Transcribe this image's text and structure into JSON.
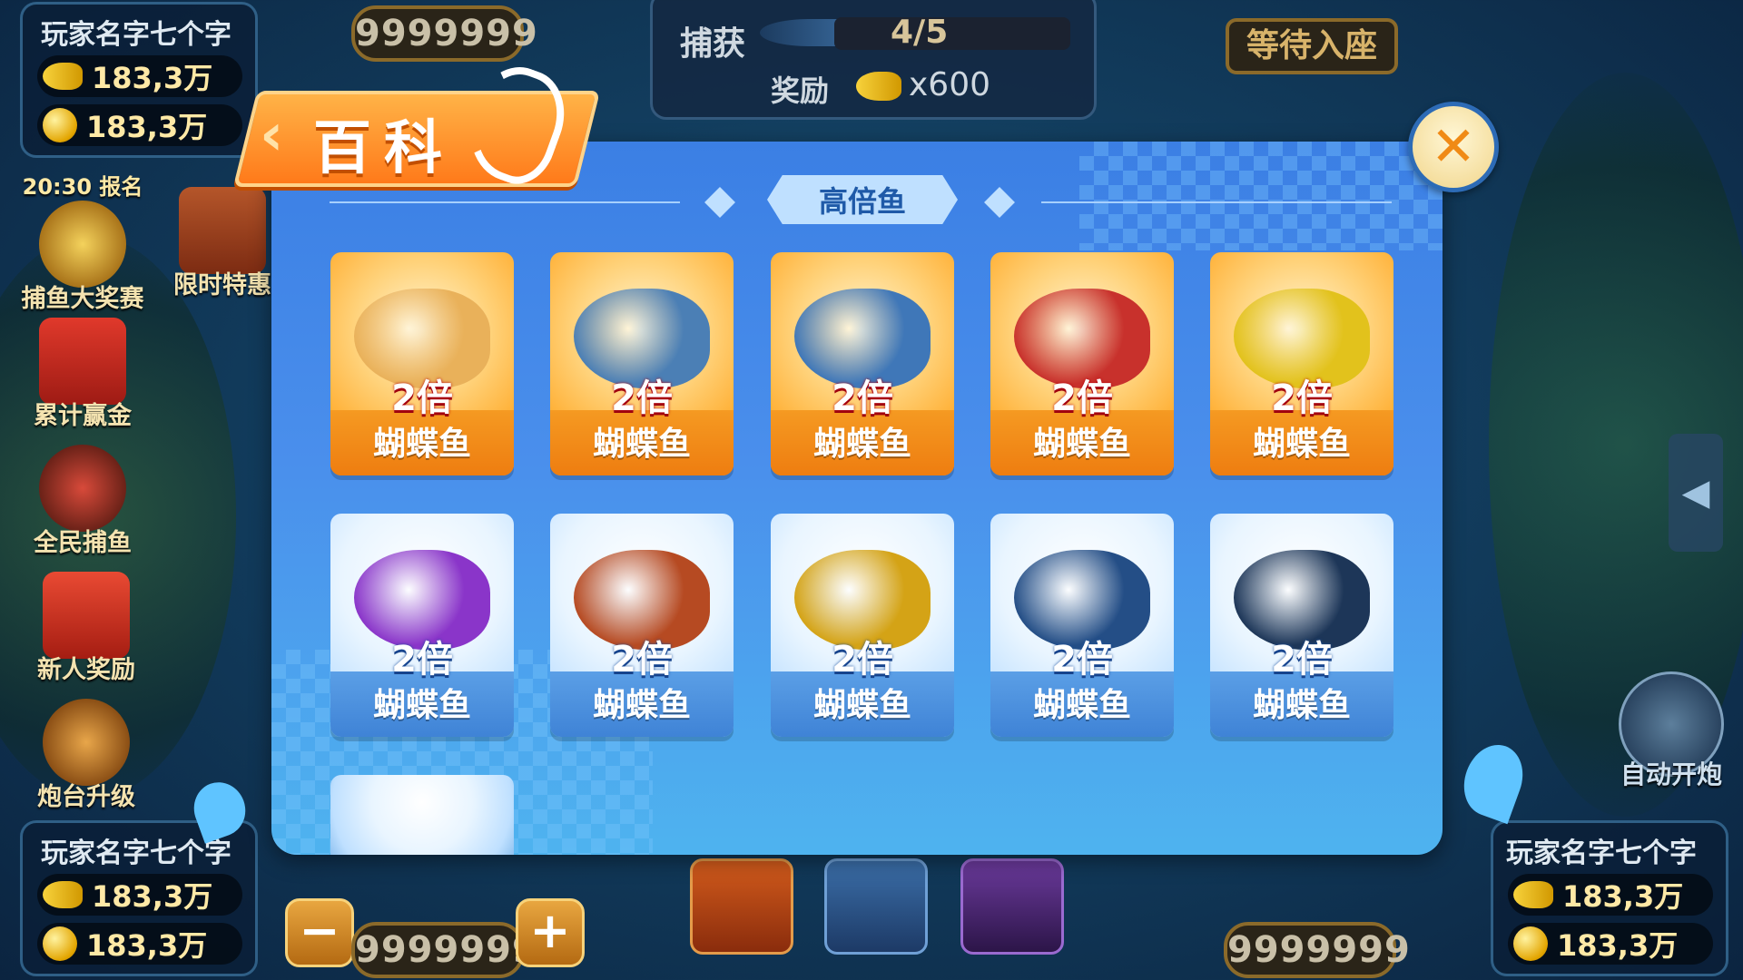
{
  "hud": {
    "top_counter": "9999999",
    "capture": {
      "label": "捕获",
      "progress": "4/5",
      "reward_label": "奖励",
      "reward_value": "x600"
    },
    "wait_seat": "等待入座",
    "bottom_left_counter": "9999999",
    "bottom_right_counter": "9999999",
    "auto_fire": "自动开炮"
  },
  "players": [
    {
      "name": "玩家名字七个字",
      "fish_amount": "183,3万",
      "coin_amount": "183,3万"
    },
    {
      "name": "玩家名字七个字",
      "fish_amount": "183,3万",
      "coin_amount": "183,3万"
    },
    {
      "name": "玩家名字七个字",
      "fish_amount": "183,3万",
      "coin_amount": "183,3万"
    }
  ],
  "sidebar": {
    "event_time": "20:30 报名",
    "items": [
      {
        "label": "捕鱼大奖赛",
        "icon": "trophy-icon"
      },
      {
        "label": "限时特惠",
        "icon": "treasure-chest-icon"
      },
      {
        "label": "累计赢金",
        "icon": "red-envelope-icon"
      },
      {
        "label": "全民捕鱼",
        "icon": "crab-badge-icon"
      },
      {
        "label": "新人奖励",
        "icon": "gift-box-icon"
      },
      {
        "label": "炮台升级",
        "icon": "cannon-icon"
      }
    ]
  },
  "controls": {
    "minus": "−",
    "plus": "+"
  },
  "modal": {
    "title": "百科",
    "close": "✕",
    "category": "高倍鱼",
    "cards_row1": [
      {
        "mult": "2倍",
        "name": "蝴蝶鱼",
        "creature": "mermaid",
        "color": "#e9b15a"
      },
      {
        "mult": "2倍",
        "name": "蝴蝶鱼",
        "creature": "shark",
        "color": "#4b7fb5"
      },
      {
        "mult": "2倍",
        "name": "蝴蝶鱼",
        "creature": "manta-ray",
        "color": "#3f77b8"
      },
      {
        "mult": "2倍",
        "name": "蝴蝶鱼",
        "creature": "lobster",
        "color": "#c8312c"
      },
      {
        "mult": "2倍",
        "name": "蝴蝶鱼",
        "creature": "tiger-shark",
        "color": "#e2c21c"
      }
    ],
    "cards_row2": [
      {
        "mult": "2倍",
        "name": "蝴蝶鱼",
        "creature": "purple-fish",
        "color": "#8a35c9"
      },
      {
        "mult": "2倍",
        "name": "蝴蝶鱼",
        "creature": "robot-crab",
        "color": "#b64a22"
      },
      {
        "mult": "2倍",
        "name": "蝴蝶鱼",
        "creature": "golden-toad",
        "color": "#d4a316"
      },
      {
        "mult": "2倍",
        "name": "蝴蝶鱼",
        "creature": "whale",
        "color": "#244e86"
      },
      {
        "mult": "2倍",
        "name": "蝴蝶鱼",
        "creature": "orca",
        "color": "#1d3658"
      }
    ]
  }
}
